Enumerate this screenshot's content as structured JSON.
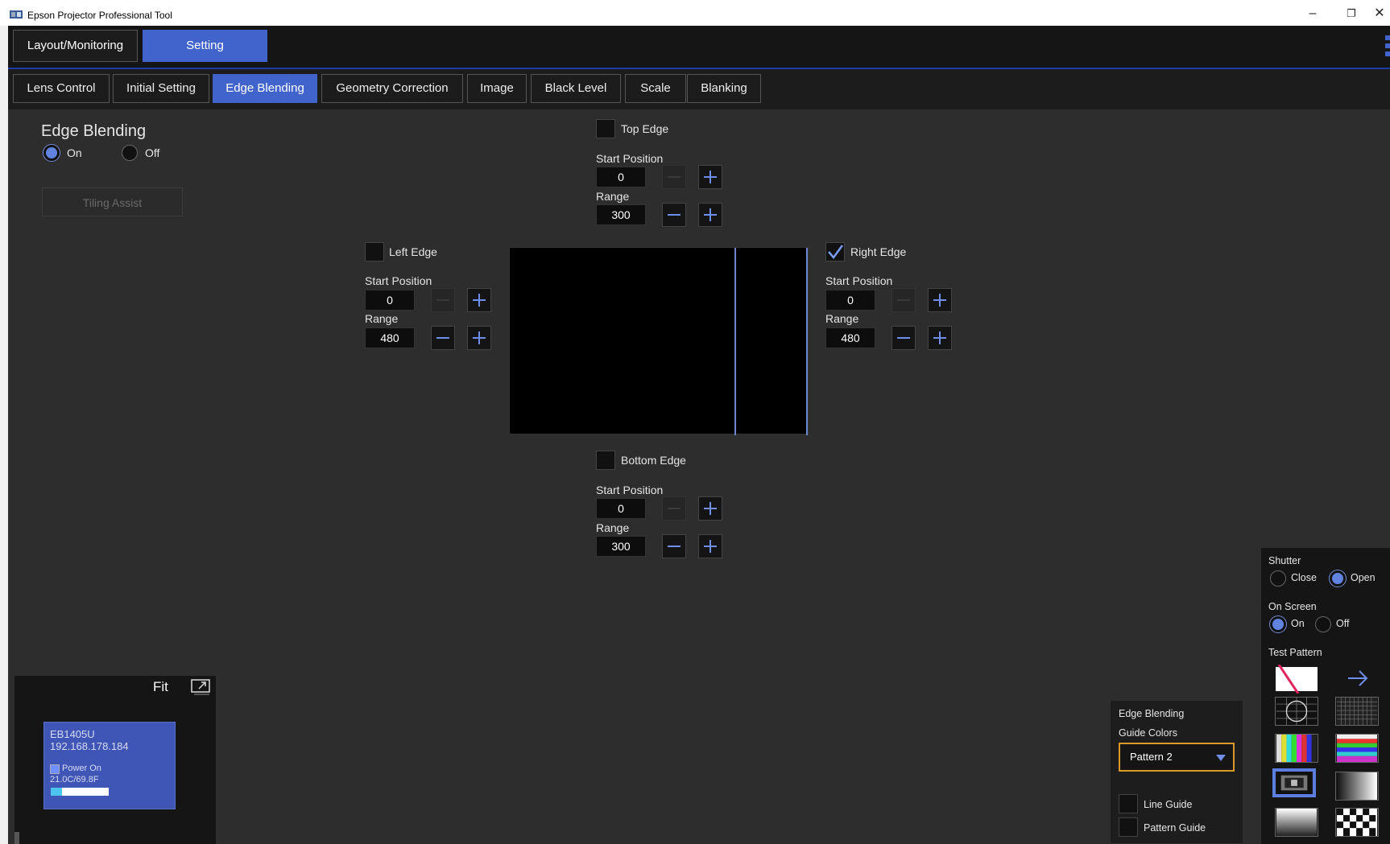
{
  "window": {
    "title": "Epson Projector Professional Tool",
    "icons": [
      "app-icon",
      "minimize-icon",
      "restore-icon",
      "close-icon"
    ],
    "minimize": "–",
    "restore": "❐",
    "close": "✕"
  },
  "main_tabs": [
    {
      "label": "Layout/Monitoring",
      "active": false
    },
    {
      "label": "Setting",
      "active": true
    }
  ],
  "sub_tabs": [
    {
      "label": "Lens Control",
      "active": false
    },
    {
      "label": "Initial Setting",
      "active": false
    },
    {
      "label": "Edge Blending",
      "active": true
    },
    {
      "label": "Geometry Correction",
      "active": false
    },
    {
      "label": "Image",
      "active": false
    },
    {
      "label": "Black Level",
      "active": false
    },
    {
      "label": "Scale",
      "active": false
    },
    {
      "label": "Blanking",
      "active": false
    }
  ],
  "edge_blending": {
    "title": "Edge Blending",
    "on_label": "On",
    "off_label": "Off",
    "selected": "On",
    "tiling_assist": "Tiling Assist"
  },
  "edges": {
    "top": {
      "label": "Top Edge",
      "checked": false,
      "start_label": "Start Position",
      "start": "0",
      "range_label": "Range",
      "range": "300"
    },
    "left": {
      "label": "Left Edge",
      "checked": false,
      "start_label": "Start Position",
      "start": "0",
      "range_label": "Range",
      "range": "480"
    },
    "right": {
      "label": "Right Edge",
      "checked": true,
      "start_label": "Start Position",
      "start": "0",
      "range_label": "Range",
      "range": "480"
    },
    "bottom": {
      "label": "Bottom Edge",
      "checked": false,
      "start_label": "Start Position",
      "start": "0",
      "range_label": "Range",
      "range": "300"
    }
  },
  "layout_panel": {
    "fit_label": "Fit",
    "projector": {
      "model": "EB1405U",
      "ip": "192.168.178.184",
      "status": "Power On",
      "temperature": "21.0C/69.8F",
      "bar_fraction": 0.2
    }
  },
  "guide_panel": {
    "title": "Edge Blending",
    "guide_colors_label": "Guide Colors",
    "pattern_value": "Pattern 2",
    "line_guide_label": "Line Guide",
    "pattern_guide_label": "Pattern Guide"
  },
  "right_panel": {
    "shutter_label": "Shutter",
    "shutter_close": "Close",
    "shutter_open": "Open",
    "shutter_selected": "Open",
    "on_screen_label": "On Screen",
    "on_screen_on": "On",
    "on_screen_off": "Off",
    "on_screen_selected": "On",
    "test_pattern_label": "Test Pattern",
    "patterns": [
      "off-pattern",
      "next-arrow",
      "circle-grid-pattern",
      "grid-pattern",
      "color-bars-pattern",
      "rgb-stripes-pattern",
      "cross-hatch-pattern",
      "horizontal-gradient-pattern",
      "vertical-gradient-pattern",
      "checkerboard-pattern"
    ],
    "selected_pattern": "cross-hatch-pattern"
  },
  "colors": {
    "accent": "#4164cc",
    "background": "#2d2d2d",
    "dropdown_border": "#d99a2a"
  }
}
